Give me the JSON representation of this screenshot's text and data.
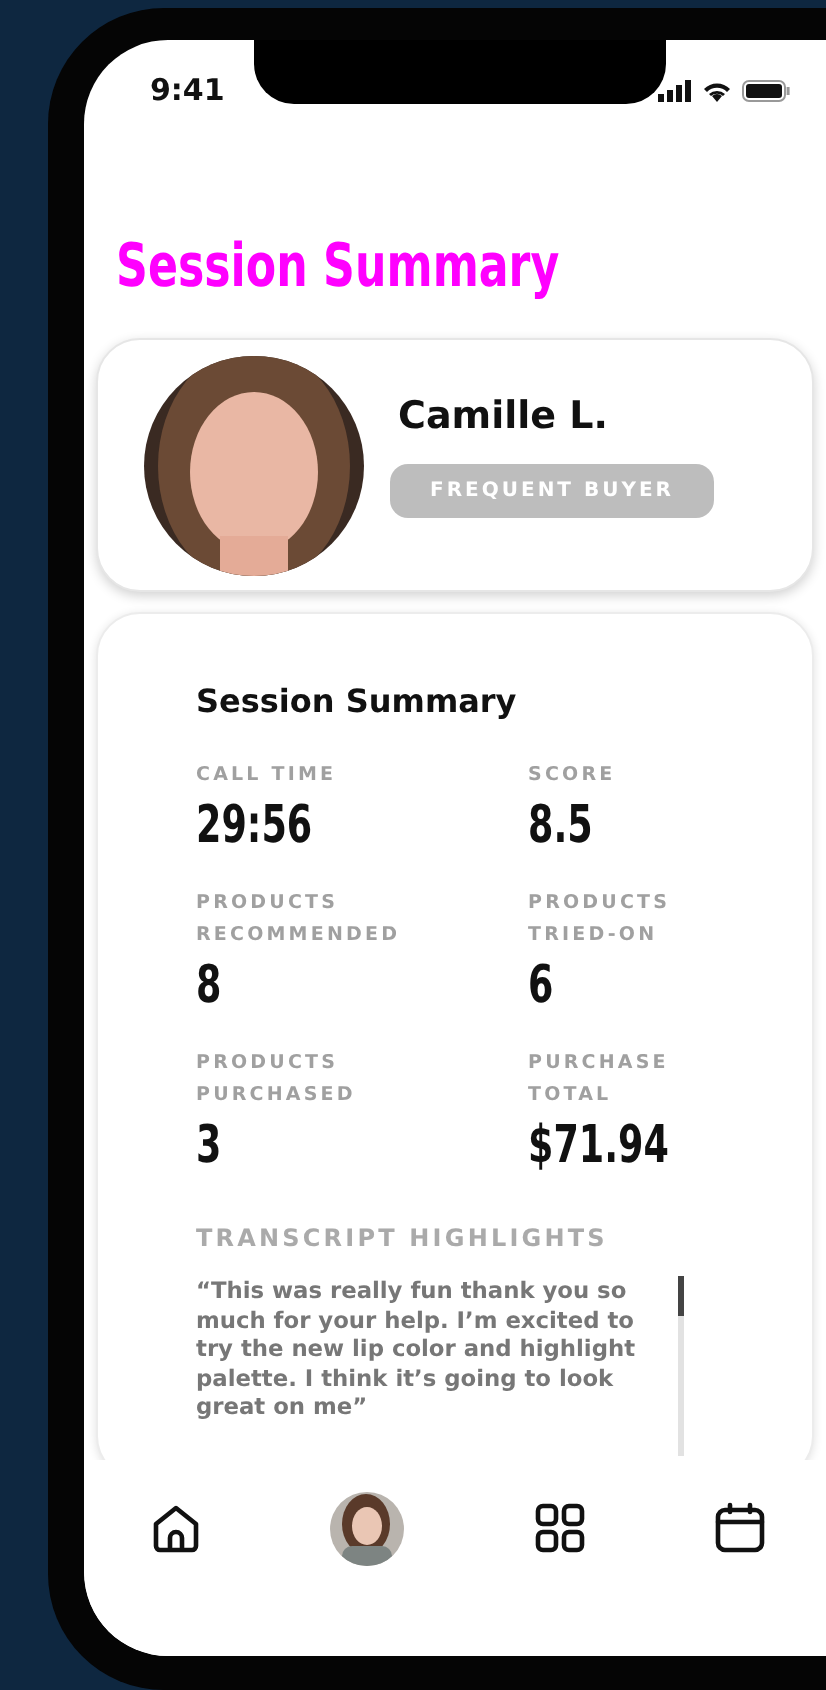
{
  "status_bar": {
    "time": "9:41"
  },
  "title": "Session Summary",
  "profile": {
    "name": "Camille L.",
    "badge": "FREQUENT BUYER"
  },
  "summary": {
    "heading": "Session Summary",
    "stats": [
      {
        "label": "CALL TIME",
        "value": "29:56"
      },
      {
        "label": "SCORE",
        "value": "8.5"
      },
      {
        "label": "PRODUCTS\nRECOMMENDED",
        "value": "8"
      },
      {
        "label": "PRODUCTS\nTRIED-ON",
        "value": "6"
      },
      {
        "label": "PRODUCTS\nPURCHASED",
        "value": "3"
      },
      {
        "label": "PURCHASE\nTOTAL",
        "value": "$71.94"
      }
    ],
    "transcript_heading": "TRANSCRIPT HIGHLIGHTS",
    "transcript": "“This was really fun thank you so much for your help. I’m excited to try the new lip color and highlight palette. I think it’s going to look great on me”"
  },
  "nav": [
    {
      "kind": "home"
    },
    {
      "kind": "avatar"
    },
    {
      "kind": "grid"
    },
    {
      "kind": "calendar"
    }
  ]
}
